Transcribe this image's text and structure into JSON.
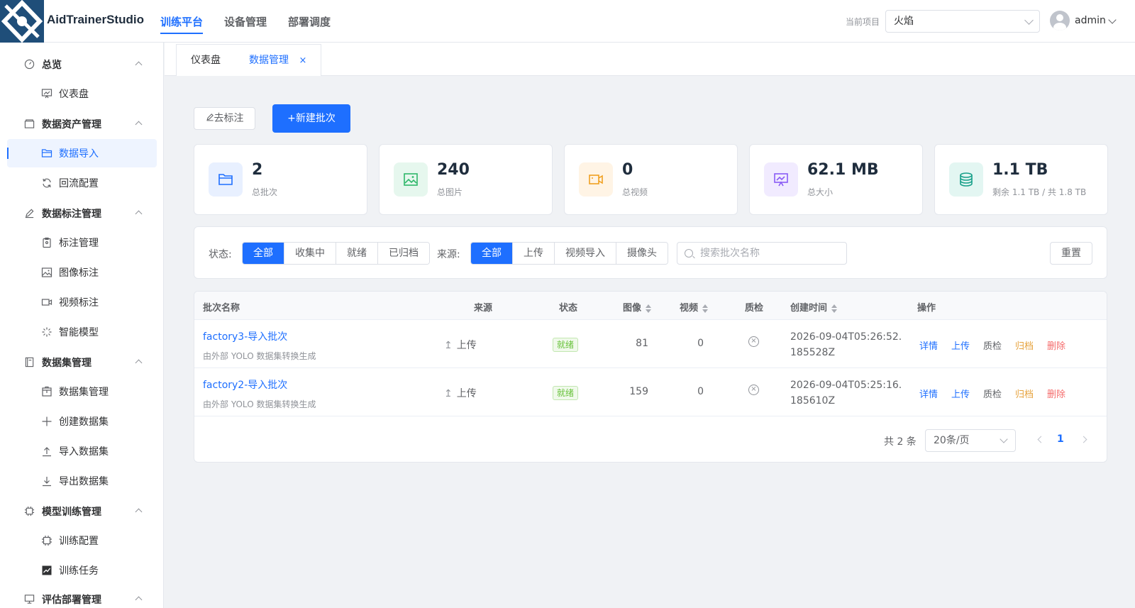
{
  "header": {
    "app_name": "AidTrainerStudio",
    "nav": [
      {
        "label": "训练平台",
        "active": true
      },
      {
        "label": "设备管理",
        "active": false
      },
      {
        "label": "部署调度",
        "active": false
      }
    ],
    "project_label": "当前项目",
    "project_value": "火焰",
    "user": "admin"
  },
  "sidebar": {
    "groups": [
      {
        "label": "总览",
        "icon": "dashboard-gauge-icon",
        "items": [
          {
            "label": "仪表盘",
            "icon": "presentation-icon"
          }
        ]
      },
      {
        "label": "数据资产管理",
        "icon": "archive-box-icon",
        "items": [
          {
            "label": "数据导入",
            "icon": "folder-open-icon",
            "active": true
          },
          {
            "label": "回流配置",
            "icon": "refresh-icon"
          }
        ]
      },
      {
        "label": "数据标注管理",
        "icon": "edit-pen-icon",
        "items": [
          {
            "label": "标注管理",
            "icon": "document-check-icon"
          },
          {
            "label": "图像标注",
            "icon": "picture-icon"
          },
          {
            "label": "视频标注",
            "icon": "video-camera-icon"
          },
          {
            "label": "智能模型",
            "icon": "magic-stick-icon"
          }
        ]
      },
      {
        "label": "数据集管理",
        "icon": "notebook-icon",
        "items": [
          {
            "label": "数据集管理",
            "icon": "box-icon"
          },
          {
            "label": "创建数据集",
            "icon": "plus-icon"
          },
          {
            "label": "导入数据集",
            "icon": "upload-icon"
          },
          {
            "label": "导出数据集",
            "icon": "download-icon"
          }
        ]
      },
      {
        "label": "模型训练管理",
        "icon": "cpu-chip-icon",
        "items": [
          {
            "label": "训练配置",
            "icon": "cpu-chip-icon"
          },
          {
            "label": "训练任务",
            "icon": "trend-chart-icon"
          }
        ]
      },
      {
        "label": "评估部署管理",
        "icon": "monitor-icon",
        "items": []
      }
    ]
  },
  "tabs": [
    {
      "label": "仪表盘",
      "active": false
    },
    {
      "label": "数据管理",
      "active": true,
      "close": "×"
    }
  ],
  "actions": {
    "mark_label": "去标注",
    "new_batch_label": "+新建批次"
  },
  "stats": [
    {
      "value": "2",
      "label": "总批次",
      "icon": "folder-icon",
      "color": "#1e6fff",
      "bg": "#e8f0ff"
    },
    {
      "value": "240",
      "label": "总图片",
      "icon": "picture-icon",
      "color": "#2fb86a",
      "bg": "#e6f7ee"
    },
    {
      "value": "0",
      "label": "总视频",
      "icon": "video-camera-icon",
      "color": "#f0a020",
      "bg": "#fff4e5"
    },
    {
      "value": "62.1 MB",
      "label": "总大小",
      "icon": "presentation-icon",
      "color": "#8a5cf5",
      "bg": "#f1ebff"
    },
    {
      "value": "1.1 TB",
      "label": "剩余 1.1 TB / 共 1.8 TB",
      "icon": "database-coins-icon",
      "color": "#18a08a",
      "bg": "#e3f6f2"
    }
  ],
  "filters": {
    "status_label": "状态:",
    "status_options": [
      "全部",
      "收集中",
      "就绪",
      "已归档"
    ],
    "status_selected": "全部",
    "source_label": "来源:",
    "source_options": [
      "全部",
      "上传",
      "视频导入",
      "摄像头"
    ],
    "source_selected": "全部",
    "search_placeholder": "搜索批次名称",
    "search_value": "",
    "reset_label": "重置"
  },
  "table": {
    "headers": {
      "name": "批次名称",
      "source": "来源",
      "status": "状态",
      "images": "图像",
      "videos": "视频",
      "qc": "质检",
      "created": "创建时间",
      "ops": "操作"
    },
    "rows": [
      {
        "name": "factory3-导入批次",
        "desc": "由外部 YOLO 数据集转换生成",
        "source": "上传",
        "status": "就绪",
        "images": "81",
        "videos": "0",
        "qc_icon": "circle-close-icon",
        "created": "2026-09-04T05:26:52.185528Z"
      },
      {
        "name": "factory2-导入批次",
        "desc": "由外部 YOLO 数据集转换生成",
        "source": "上传",
        "status": "就绪",
        "images": "159",
        "videos": "0",
        "qc_icon": "circle-close-icon",
        "created": "2026-09-04T05:25:16.185610Z"
      }
    ],
    "row_actions": [
      "详情",
      "上传",
      "质检",
      "归档",
      "删除"
    ]
  },
  "pagination": {
    "total_text": "共 2 条",
    "page_size": "20条/页",
    "current_page": "1"
  }
}
